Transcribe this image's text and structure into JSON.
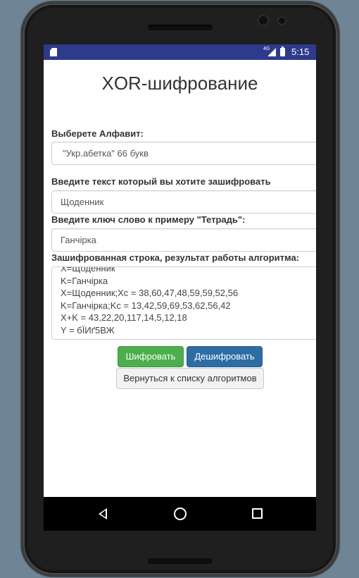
{
  "statusbar": {
    "network": "4G",
    "time": "5:15"
  },
  "app": {
    "title": "XOR-шифрование",
    "alphabet_label": "Выберете Алфавит:",
    "alphabet_value": "\"Укр.абетка\" 66 букв",
    "text_label": "Введите текст который вы хотите зашифровать",
    "text_value": "Щоденник",
    "key_label": "Введите ключ слово к примеру \"Тетрадь\":",
    "key_value": "Ганчірка",
    "result_label": "Зашифрованная строка, результат работы алгоритма:",
    "result_lines": [
      "X=Щоденник",
      "K=Ганчірка",
      "X=Щоденник;Xc = 38,60,47,48,59,59,52,56",
      "K=Ганчірка;Kc = 13,42,59,69,53,62,56,42",
      "X+K = 43,22,20,117,14,5,12,18",
      "Y = бЇИґ5ВЖ"
    ],
    "encrypt_button": "Шифровать",
    "decrypt_button": "Дешифровать",
    "back_button": "Вернуться к списку алгоритмов"
  },
  "colors": {
    "statusbar": "#2e3a8c",
    "encrypt_button": "#4cae4c",
    "decrypt_button": "#2e6da4"
  },
  "icons": {
    "status": [
      "sd-card-icon",
      "signal-icon",
      "battery-icon"
    ],
    "navigation": [
      "back-icon",
      "home-icon",
      "recent-apps-icon"
    ]
  }
}
